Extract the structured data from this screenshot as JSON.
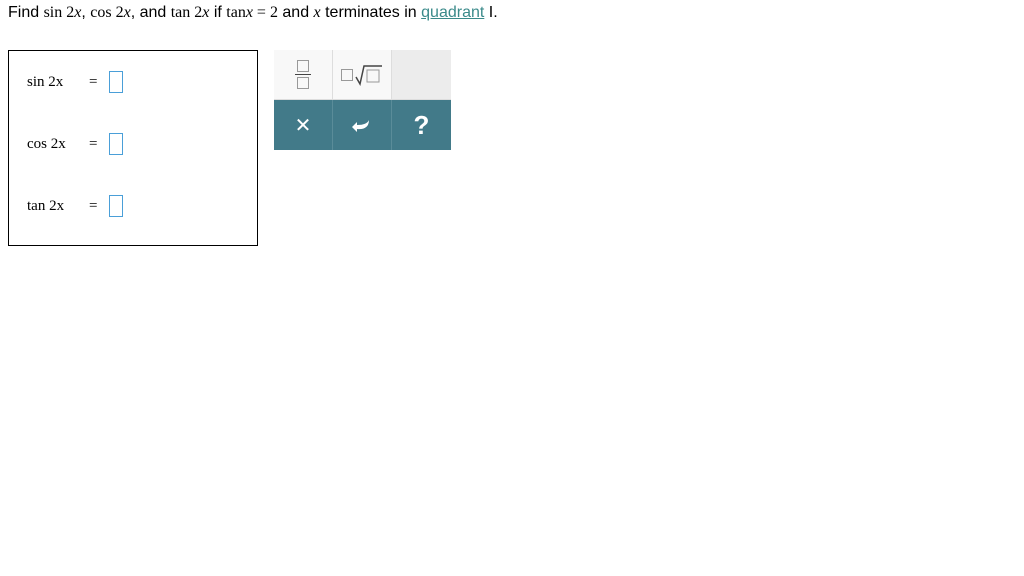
{
  "question": {
    "prefix": "Find ",
    "term1": "sin 2",
    "var1": "x",
    "sep1": ", ",
    "term2": "cos 2",
    "var2": "x",
    "sep2": ", and ",
    "term3": "tan 2",
    "var3": "x",
    "if_text": " if ",
    "cond": "tan",
    "cond_var": "x",
    "cond_eq": " = 2",
    "mid": " and ",
    "var4": "x",
    "mid2": " terminates in ",
    "link": "quadrant",
    "suffix": " I."
  },
  "answers": {
    "row1_label": "sin 2",
    "row1_var": "x",
    "row2_label": "cos 2",
    "row2_var": "x",
    "row3_label": "tan 2",
    "row3_var": "x",
    "equals": "="
  },
  "palette": {
    "clear": "✕",
    "help": "?"
  }
}
